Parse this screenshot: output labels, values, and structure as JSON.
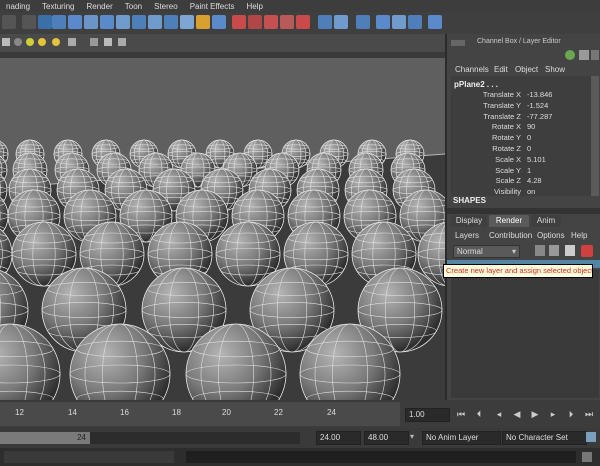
{
  "menubar": {
    "items": [
      "nading",
      "Texturing",
      "Render",
      "Toon",
      "Stereo",
      "Paint Effects",
      "Help"
    ]
  },
  "channel_box": {
    "title": "Channel Box / Layer Editor",
    "menus": [
      "Channels",
      "Edit",
      "Object",
      "Show"
    ],
    "object_name": "pPlane2 . . .",
    "attributes": [
      {
        "label": "Translate X",
        "value": "-13.846"
      },
      {
        "label": "Translate Y",
        "value": "-1.524"
      },
      {
        "label": "Translate Z",
        "value": "-77.287"
      },
      {
        "label": "Rotate X",
        "value": "90"
      },
      {
        "label": "Rotate Y",
        "value": "0"
      },
      {
        "label": "Rotate Z",
        "value": "0"
      },
      {
        "label": "Scale X",
        "value": "5.101"
      },
      {
        "label": "Scale Y",
        "value": "1"
      },
      {
        "label": "Scale Z",
        "value": "4.28"
      },
      {
        "label": "Visibility",
        "value": "on"
      }
    ],
    "shapes_header": "SHAPES"
  },
  "layer_editor": {
    "tabs": [
      "Display",
      "Render",
      "Anim"
    ],
    "active_tab": "Render",
    "menus": [
      "Layers",
      "Contribution",
      "Options",
      "Help"
    ],
    "blend_mode": "Normal",
    "tooltip": "Create new layer and assign selected objects"
  },
  "timeline": {
    "ticks": [
      "12",
      "14",
      "16",
      "18",
      "20",
      "22",
      "24"
    ],
    "current_frame": "1.00"
  },
  "range": {
    "slider_end": "24",
    "end_time": "24.00",
    "max_time": "48.00",
    "anim_layer": "No Anim Layer",
    "character_set": "No Character Set"
  },
  "colors": {
    "accent_selected": "#5285a6",
    "tooltip_bg": "#ffffdc",
    "tooltip_text": "#dd2222"
  }
}
